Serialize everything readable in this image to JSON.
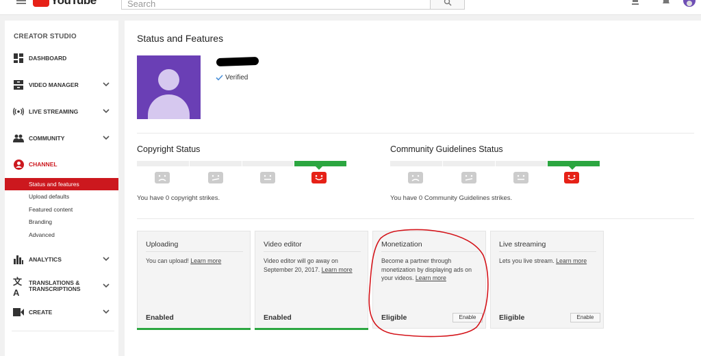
{
  "topbar": {
    "logo_text": "YouTube",
    "search_placeholder": "Search"
  },
  "sidebar": {
    "title": "CREATOR STUDIO",
    "items": [
      {
        "label": "DASHBOARD",
        "icon": "dashboard-icon"
      },
      {
        "label": "VIDEO MANAGER",
        "icon": "video-manager-icon"
      },
      {
        "label": "LIVE STREAMING",
        "icon": "live-streaming-icon"
      },
      {
        "label": "COMMUNITY",
        "icon": "community-icon"
      },
      {
        "label": "CHANNEL",
        "icon": "channel-icon"
      },
      {
        "label": "ANALYTICS",
        "icon": "analytics-icon"
      },
      {
        "label": "TRANSLATIONS & TRANSCRIPTIONS",
        "label_line1": "TRANSLATIONS &",
        "label_line2": "TRANSCRIPTIONS",
        "icon": "translate-icon"
      },
      {
        "label": "CREATE",
        "icon": "create-icon"
      }
    ],
    "channel_subitems": [
      "Status and features",
      "Upload defaults",
      "Featured content",
      "Branding",
      "Advanced"
    ],
    "active_subitem": "Status and features",
    "accent_color": "#cc181e"
  },
  "main": {
    "title": "Status and Features",
    "channel_name": "",
    "verified_label": "Verified",
    "copyright": {
      "title": "Copyright Status",
      "strikes_text": "You have 0 copyright strikes.",
      "active_level": 4
    },
    "community": {
      "title": "Community Guidelines Status",
      "strikes_text": "You have 0 Community Guidelines strikes.",
      "active_level": 4
    },
    "cards": [
      {
        "title": "Uploading",
        "desc": "You can upload! ",
        "link": "Learn more",
        "status": "Enabled",
        "button": ""
      },
      {
        "title": "Video editor",
        "desc": "Video editor will go away on September 20, 2017. ",
        "link": "Learn more",
        "status": "Enabled",
        "button": ""
      },
      {
        "title": "Monetization",
        "desc": "Become a partner through monetization by displaying ads on your videos. ",
        "link": "Learn more",
        "status": "Eligible",
        "button": "Enable"
      },
      {
        "title": "Live streaming",
        "desc": "Lets you live stream. ",
        "link": "Learn more",
        "status": "Eligible",
        "button": "Enable"
      }
    ],
    "status_green": "#2ba640",
    "strike_red": "#e62117"
  }
}
